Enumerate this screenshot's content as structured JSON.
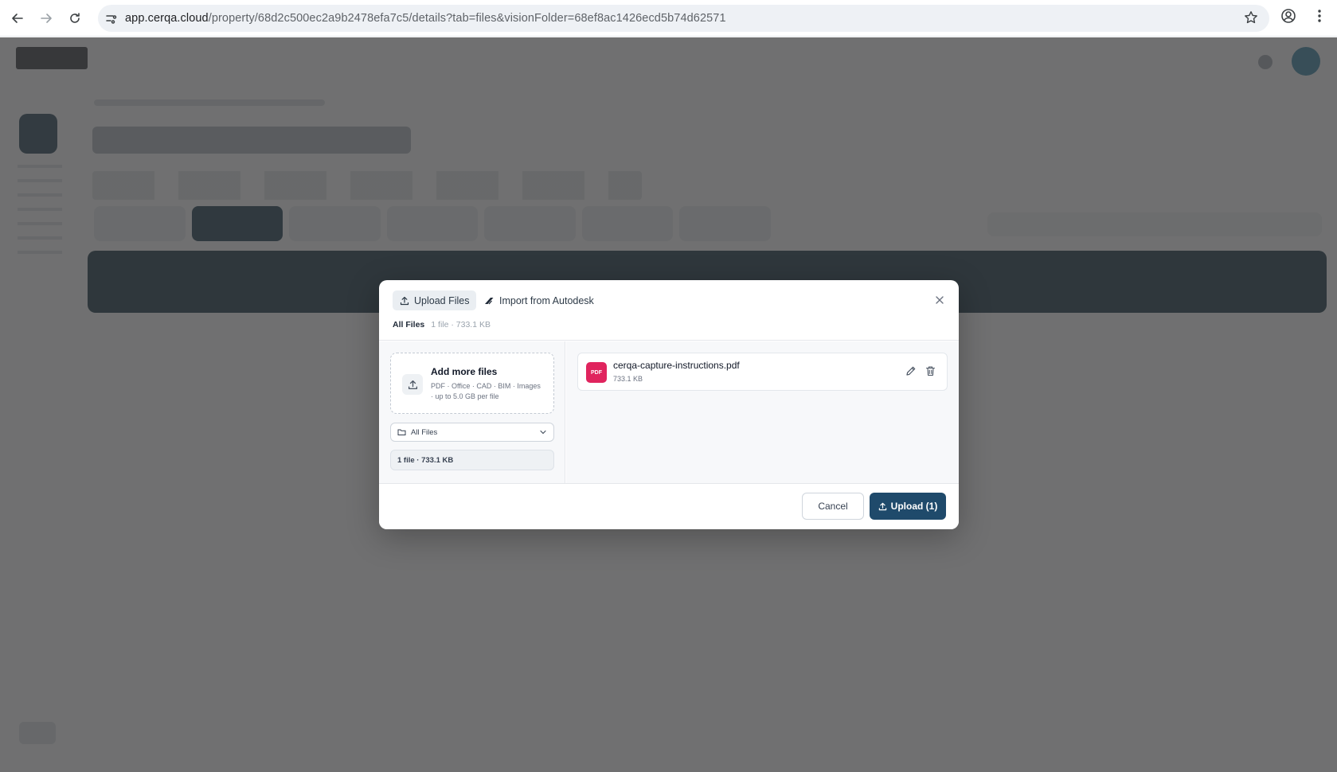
{
  "browser": {
    "url_host": "app.cerqa.cloud",
    "url_path": "/property/68d2c500ec2a9b2478efa7c5/details?tab=files&visionFolder=68ef8ac1426ecd5b74d62571"
  },
  "modal": {
    "tabs": [
      {
        "label": "Upload Files",
        "icon": "upload-icon",
        "active": true
      },
      {
        "label": "Import from Autodesk",
        "icon": "autodesk-icon",
        "active": false
      }
    ],
    "breadcrumb": {
      "folder": "All Files",
      "summary": "1 file · 733.1 KB"
    },
    "dropzone": {
      "title": "Add more files",
      "subtitle": "PDF · Office · CAD · BIM · Images · up to 5.0 GB per file"
    },
    "folder_select": {
      "value": "All Files"
    },
    "count_summary": "1 file · 733.1 KB",
    "files": [
      {
        "badge": "PDF",
        "name": "cerqa-capture-instructions.pdf",
        "size": "733.1 KB"
      }
    ],
    "cancel_label": "Cancel",
    "upload_label": "Upload (1)"
  },
  "colors": {
    "primary": "#1f4a6b",
    "pdf_badge": "#e0245e",
    "overlay": "rgba(60,60,60,0.72)"
  }
}
